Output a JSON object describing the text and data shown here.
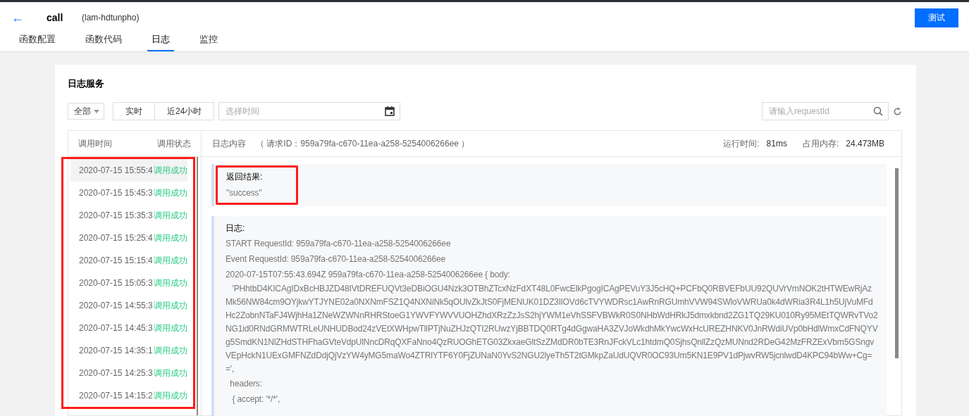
{
  "header": {
    "back": "←",
    "title": "call",
    "subtitle": "(lam-hdtunpho)",
    "test_button": "测试"
  },
  "tabs": [
    {
      "label": "函数配置",
      "selected": false
    },
    {
      "label": "函数代码",
      "selected": false
    },
    {
      "label": "日志",
      "selected": true
    },
    {
      "label": "监控",
      "selected": false
    }
  ],
  "log_service": {
    "title": "日志服务",
    "filter": {
      "dropdown": "全部",
      "ranges": [
        {
          "label": "实时",
          "selected": false
        },
        {
          "label": "近24小时",
          "selected": false
        }
      ],
      "date_placeholder": "选择时间",
      "search_placeholder": "请输入requestId"
    },
    "columns": [
      "调用时间",
      "调用状态"
    ],
    "content_header": {
      "label": "日志内容",
      "request": "（ 请求ID：959a79fa-c670-11ea-a258-5254006266ee ）",
      "runtime_label": "运行时间:",
      "runtime": "81ms",
      "memory_label": "占用内存:",
      "memory": "24.473MB"
    },
    "invocations_highlighted": true,
    "invocations": [
      {
        "time": "2020-07-15 15:55:4",
        "status": "调用成功",
        "selected": true
      },
      {
        "time": "2020-07-15 15:45:3",
        "status": "调用成功",
        "selected": false
      },
      {
        "time": "2020-07-15 15:35:3",
        "status": "调用成功",
        "selected": false
      },
      {
        "time": "2020-07-15 15:25:4",
        "status": "调用成功",
        "selected": false
      },
      {
        "time": "2020-07-15 15:15:4",
        "status": "调用成功",
        "selected": false
      },
      {
        "time": "2020-07-15 15:05:3",
        "status": "调用成功",
        "selected": false
      },
      {
        "time": "2020-07-15 14:55:3",
        "status": "调用成功",
        "selected": false
      },
      {
        "time": "2020-07-15 14:45:3",
        "status": "调用成功",
        "selected": false
      },
      {
        "time": "2020-07-15 14:35:1",
        "status": "调用成功",
        "selected": false
      },
      {
        "time": "2020-07-15 14:25:3",
        "status": "调用成功",
        "selected": false
      },
      {
        "time": "2020-07-15 14:15:2",
        "status": "调用成功",
        "selected": false
      }
    ],
    "result": {
      "label": "返回结果:",
      "value": "\"success\"",
      "highlighted": true
    },
    "log": {
      "label": "日志:",
      "lines": [
        {
          "kind": "line",
          "text": "START RequestId: 959a79fa-c670-11ea-a258-5254006266ee"
        },
        {
          "kind": "line",
          "text": "Event RequestId: 959a79fa-c670-11ea-a258-5254006266ee"
        },
        {
          "kind": "line",
          "text": "2020-07-15T07:55:43.694Z 959a79fa-c670-11ea-a258-5254006266ee { body:"
        },
        {
          "kind": "wrapped",
          "text": "   'PHhtbD4KICAgIDxBcHBJZD48IVtDREFUQVt3eDBiOGU4Nzk3OTBhZTcxNzFdXT48L0FwcElkPgogICAgPEVuY3J5cHQ+PCFbQ0RBVEFbUU92QUVrVmNOK2tHTWEwRjAz"
        },
        {
          "kind": "wrapped",
          "text": "Mk56NW84cm9OYjkwYTJYNE02a0NXNmFSZ1Q4NXNiNk5qOUlvZkJtS0FjMENUK01DZ3lIOVd6cTVYWDRsc1AwRnRGUmhVVW94SWloVWRUa0k4dWRia3R4L1h5UjVuMFd"
        },
        {
          "kind": "wrapped",
          "text": "Hc2ZobnNTaFJ4WjhHa1ZNeWZWNnRHRStoeG1YWVFYWVVUOHZhdXRzZzJsS2hjYWM1eVhSSFVBWkR0S0NHbWdHRkJ5dmxkbnd2ZG1TQ29KU010Ry95MEtTQWRvTVo2"
        },
        {
          "kind": "wrapped",
          "text": "NG1id0RNdGRMWTRLeUNHUDBod24zVEtXWHpwTllPTjNuZHJzQTI2RUwzYjBBTDQ0RTg4dGgwaHA3ZVJoWkdhMkYwcWxHcUREZHNKV0JnRWdiUVp0bHdlWmxCdFNQYV"
        },
        {
          "kind": "wrapped",
          "text": "g5SmdKN1NlZHdSTHFhaGVteVdpUlNncDRqQXFaNno4QzRUOGhETG03ZkxaeGltSzZMdDR0bTE3RnJFckVLc1htdmQ0SjhsQnllZzQzMUNnd2RDeG42MzFRZExVbm5GSngv"
        },
        {
          "kind": "wrapped",
          "text": "VEpHckN1UExGMFNZdDdjQjVzYW4yMG5maWo4ZTRlYTF6Y0FjZUNaN0YvS2NGU2lyeTh5T2tGMkpZaUdUQVR0OC93Um5KN1E9PV1dPjwvRW5jcnlwdD4KPC94bWw+Cg="
        },
        {
          "kind": "wrapped",
          "text": "=',"
        },
        {
          "kind": "line",
          "text": "  headers:"
        },
        {
          "kind": "line",
          "text": "   { accept: '*/*',"
        }
      ]
    }
  }
}
